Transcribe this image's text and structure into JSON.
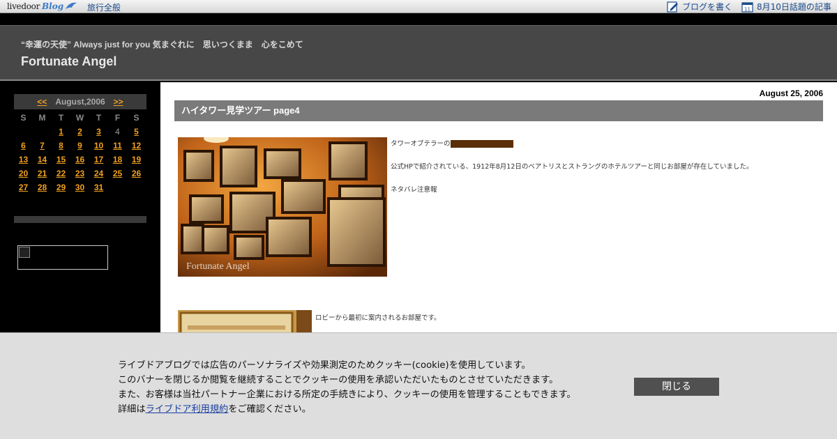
{
  "topbar": {
    "logo_livedoor": "livedoor",
    "logo_blog": "Blog",
    "category": "旅行全般",
    "write_blog": "ブログを書く",
    "trending": "8月10日話題の記事",
    "calendar_day": "11"
  },
  "header": {
    "tagline": "“幸運の天使” Always just for you 気まぐれに　思いつくまま　心をこめて",
    "title": "Fortunate Angel"
  },
  "calendar": {
    "prev": "<<",
    "month": "August,2006",
    "next": ">>",
    "weekdays": [
      "S",
      "M",
      "T",
      "W",
      "T",
      "F",
      "S"
    ],
    "days": [
      "",
      "",
      "1",
      "2",
      "3",
      "4",
      "5",
      "6",
      "7",
      "8",
      "9",
      "10",
      "11",
      "12",
      "13",
      "14",
      "15",
      "16",
      "17",
      "18",
      "19",
      "20",
      "21",
      "22",
      "23",
      "24",
      "25",
      "26",
      "27",
      "28",
      "29",
      "30",
      "31"
    ],
    "unlinked_days": [
      "4"
    ]
  },
  "post": {
    "date": "August 25, 2006",
    "title": "ハイタワー見学ツアー page4",
    "line1": "タワーオブテラーの",
    "line2": "公式HPで紹介されている、1912年8月12日のベアトリスとストラングのホテルツアーと同じお部屋が存在していました。",
    "line3": "ネタバレ注意報",
    "line4": "ロビーから最初に案内されるお部屋です。",
    "photo_watermark": "Fortunate Angel"
  },
  "cookie": {
    "line1": "ライブドアブログでは広告のパーソナライズや効果測定のためクッキー(cookie)を使用しています。",
    "line2": "このバナーを閉じるか閲覧を継続することでクッキーの使用を承認いただいたものとさせていただきます。",
    "line3": "また、お客様は当社パートナー企業における所定の手続きにより、クッキーの使用を管理することもできます。",
    "line4_prefix": "詳細は",
    "line4_link": "ライブドア利用規約",
    "line4_suffix": "をご確認ください。",
    "close_label": "閉じる"
  },
  "colors": {
    "accent_orange": "#f0a020",
    "header_bg": "#474747",
    "link_blue": "#1a4a8a"
  }
}
